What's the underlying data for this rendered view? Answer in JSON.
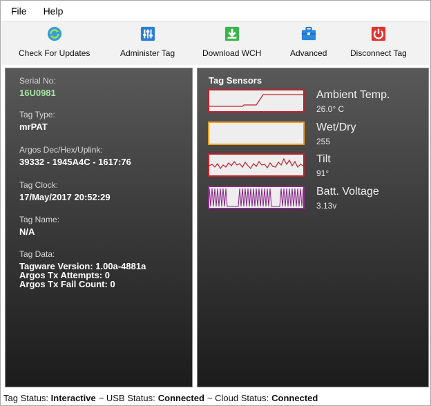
{
  "menu": {
    "file": "File",
    "help": "Help"
  },
  "toolbar": {
    "check_updates": "Check For Updates",
    "administer_tag": "Administer Tag",
    "download_wch": "Download WCH",
    "advanced": "Advanced",
    "disconnect_tag": "Disconnect Tag"
  },
  "info": {
    "serial_label": "Serial No:",
    "serial_value": "16U0981",
    "type_label": "Tag Type:",
    "type_value": "mrPAT",
    "argos_label": "Argos Dec/Hex/Uplink:",
    "argos_value": "39332 - 1945A4C - 1617:76",
    "clock_label": "Tag Clock:",
    "clock_value": "17/May/2017 20:52:29",
    "name_label": "Tag Name:",
    "name_value": "N/A",
    "data_label": "Tag Data:",
    "data_lines": [
      "Tagware Version: 1.00a-4881a",
      "Argos Tx Attempts: 0",
      "Argos Tx Fail Count: 0"
    ]
  },
  "sensors": {
    "title": "Tag Sensors",
    "items": [
      {
        "name": "Ambient Temp.",
        "value": "26.0° C",
        "border_color": "#c0202c",
        "line_color": "#c0202c"
      },
      {
        "name": "Wet/Dry",
        "value": "255",
        "border_color": "#f0a020",
        "line_color": "#f0a020"
      },
      {
        "name": "Tilt",
        "value": "91°",
        "border_color": "#c0202c",
        "line_color": "#c0202c"
      },
      {
        "name": "Batt. Voltage",
        "value": "3.13v",
        "border_color": "#8a2a8a",
        "line_color": "#8a2a8a"
      }
    ]
  },
  "status": {
    "tag_label": "Tag Status:",
    "tag_value": "Interactive",
    "usb_label": "~ USB Status:",
    "usb_value": "Connected",
    "cloud_label": "~ Cloud Status:",
    "cloud_value": "Connected"
  },
  "icons": {
    "check_updates": "refresh-icon",
    "administer_tag": "sliders-icon",
    "download_wch": "download-icon",
    "advanced": "briefcase-icon",
    "disconnect_tag": "power-icon"
  }
}
